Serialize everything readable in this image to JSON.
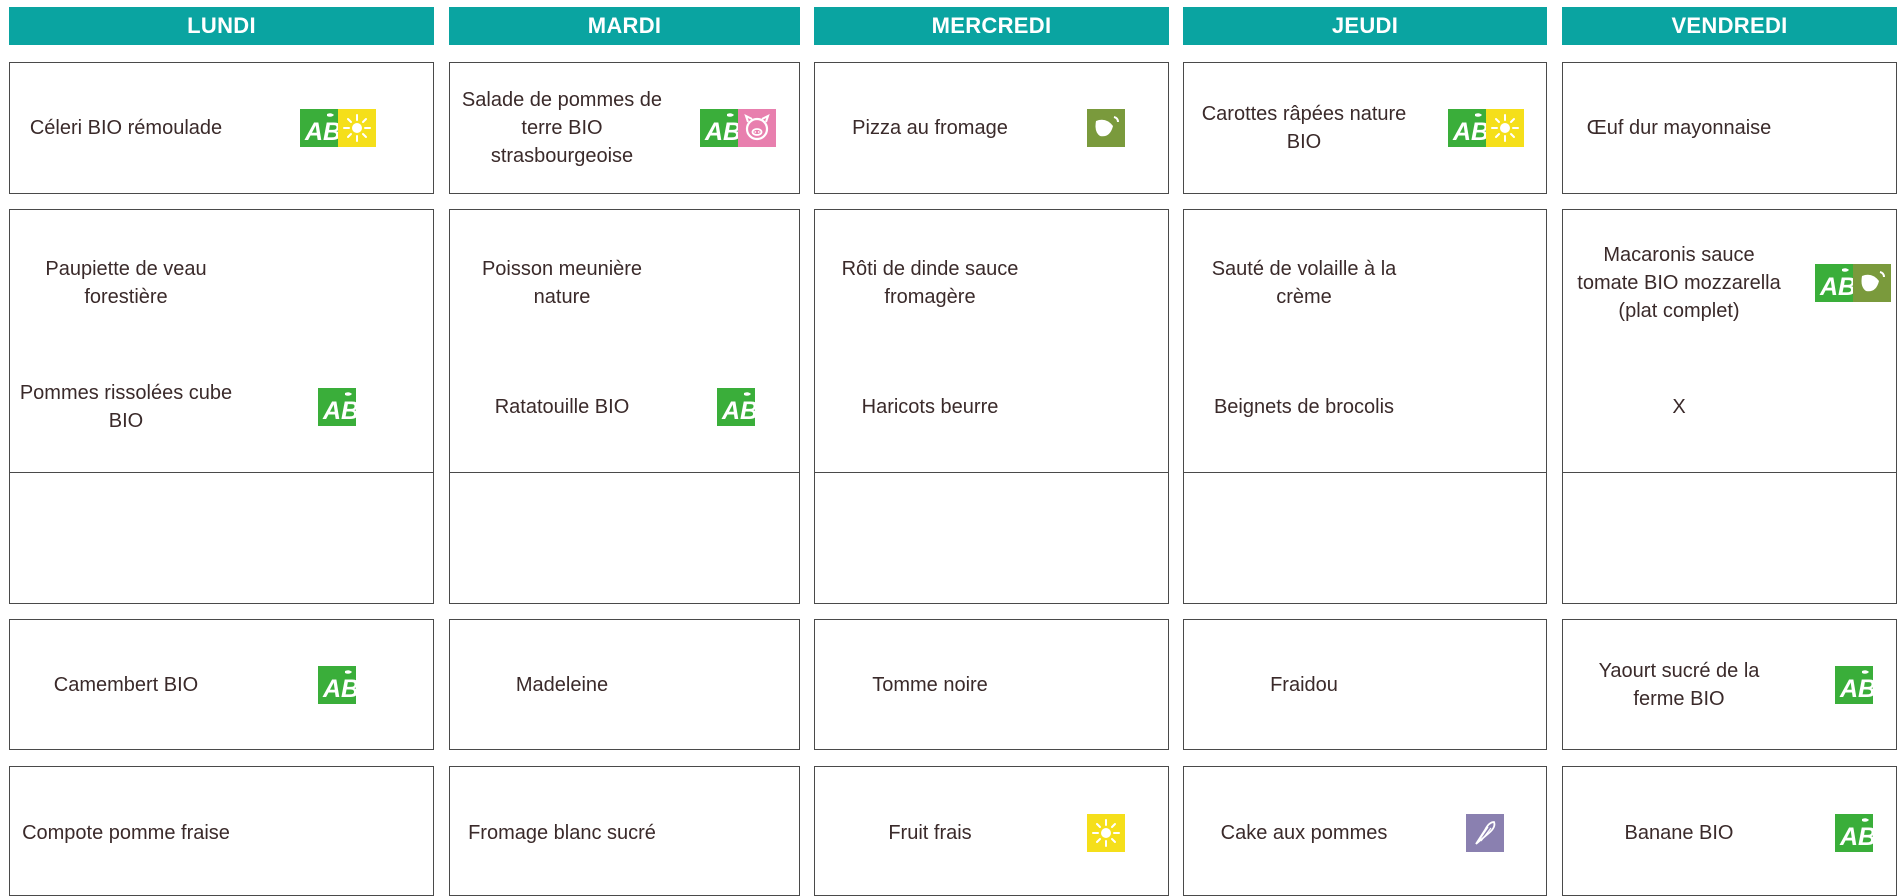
{
  "days": [
    "LUNDI",
    "MARDI",
    "MERCREDI",
    "JEUDI",
    "VENDREDI"
  ],
  "menu": {
    "entree": [
      {
        "text": "Céleri BIO rémoulade",
        "icons": [
          "ab-bio-icon",
          "sun-icon"
        ]
      },
      {
        "text": "Salade de pommes de\nterre BIO\nstrasbourgeoise",
        "icons": [
          "ab-bio-icon",
          "pig-icon"
        ]
      },
      {
        "text": "Pizza au fromage",
        "icons": [
          "leaf-icon"
        ]
      },
      {
        "text": "Carottes râpées nature\nBIO",
        "icons": [
          "ab-bio-icon",
          "sun-icon"
        ]
      },
      {
        "text": "Œuf dur mayonnaise",
        "icons": []
      }
    ],
    "plat": [
      {
        "text": "Paupiette de veau\nforestière",
        "icons": []
      },
      {
        "text": "Poisson meunière\nnature",
        "icons": []
      },
      {
        "text": "Rôti de dinde sauce\nfromagère",
        "icons": []
      },
      {
        "text": "Sauté de volaille à la\ncrème",
        "icons": []
      },
      {
        "text": "Macaronis sauce\ntomate BIO mozzarella\n(plat complet)",
        "icons": [
          "ab-bio-icon",
          "leaf-icon"
        ]
      }
    ],
    "accompagnement": [
      {
        "text": "Pommes rissolées cube\nBIO",
        "icons": [
          "ab-bio-icon"
        ]
      },
      {
        "text": "Ratatouille BIO",
        "icons": [
          "ab-bio-icon"
        ]
      },
      {
        "text": "Haricots beurre",
        "icons": []
      },
      {
        "text": "Beignets de brocolis",
        "icons": []
      },
      {
        "text": "X",
        "icons": []
      }
    ],
    "fromage": [
      {
        "text": "Camembert BIO",
        "icons": [
          "ab-bio-icon"
        ]
      },
      {
        "text": "Madeleine",
        "icons": []
      },
      {
        "text": "Tomme noire",
        "icons": []
      },
      {
        "text": "Fraidou",
        "icons": []
      },
      {
        "text": "Yaourt sucré de la\nferme BIO",
        "icons": [
          "ab-bio-icon"
        ]
      }
    ],
    "dessert": [
      {
        "text": "Compote pomme fraise",
        "icons": []
      },
      {
        "text": "Fromage blanc sucré",
        "icons": []
      },
      {
        "text": "Fruit frais",
        "icons": [
          "sun-icon"
        ]
      },
      {
        "text": "Cake aux pommes",
        "icons": [
          "whisk-icon"
        ]
      },
      {
        "text": "Banane BIO",
        "icons": [
          "ab-bio-icon"
        ]
      }
    ]
  },
  "colors": {
    "header_bg": "#0aa4a1",
    "ab_green": "#3aae3a",
    "sun_yellow": "#f5df1a",
    "pig_pink": "#e87fae",
    "leaf_green": "#7a9a3c",
    "whisk_purple": "#8a80b0"
  }
}
